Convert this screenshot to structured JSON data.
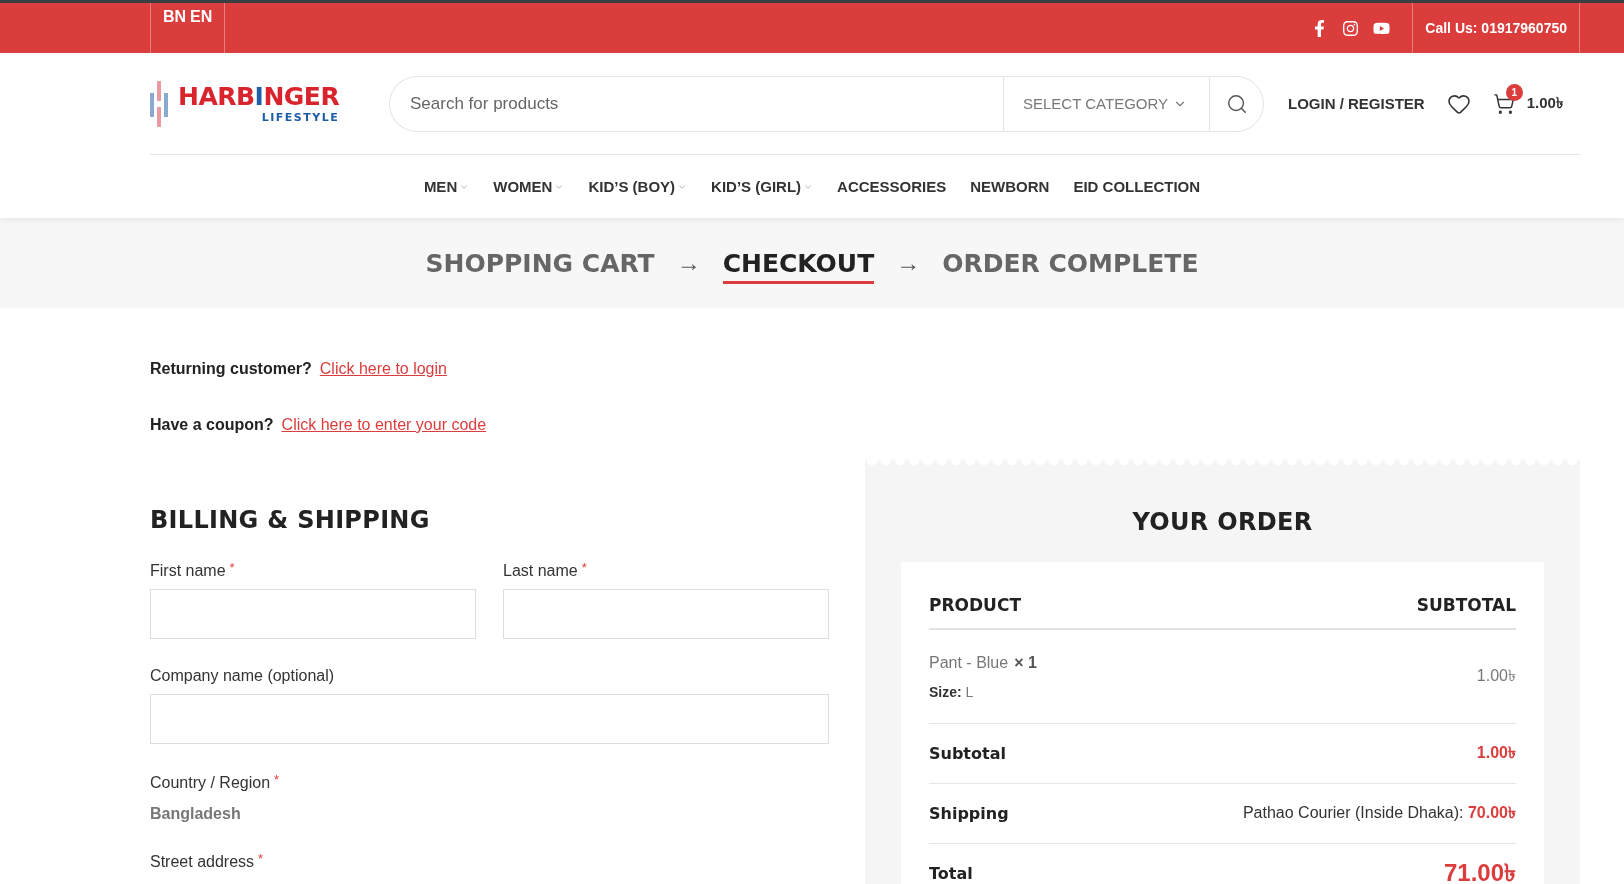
{
  "top_bar": {
    "languages": [
      "BN",
      "EN"
    ],
    "social": [
      {
        "kind": "facebook"
      },
      {
        "kind": "instagram"
      },
      {
        "kind": "youtube"
      }
    ],
    "phone": "Call Us: 01917960750"
  },
  "header": {
    "logo": {
      "parts": [
        {
          "text": "HARB",
          "color": "#d9232d"
        },
        {
          "text": "I",
          "color": "#1d5ea8"
        },
        {
          "text": "NGER",
          "color": "#d9232d"
        }
      ],
      "tagline": "LIFESTYLE"
    },
    "search": {
      "placeholder": "Search for products",
      "category": "SELECT CATEGORY"
    },
    "login": "LOGIN / REGISTER",
    "cart": {
      "count": "1",
      "total": "1.00৳"
    }
  },
  "nav": [
    {
      "label": "MEN",
      "has_dropdown": true
    },
    {
      "label": "WOMEN",
      "has_dropdown": true
    },
    {
      "label": "KID’S (BOY)",
      "has_dropdown": true
    },
    {
      "label": "KID’S (GIRL)",
      "has_dropdown": true
    },
    {
      "label": "ACCESSORIES",
      "has_dropdown": false
    },
    {
      "label": "NEWBORN",
      "has_dropdown": false
    },
    {
      "label": "EID COLLECTION",
      "has_dropdown": false
    }
  ],
  "steps": {
    "items": [
      {
        "label": "SHOPPING CART",
        "selected": false
      },
      {
        "label": "CHECKOUT",
        "selected": true
      },
      {
        "label": "ORDER COMPLETE",
        "selected": false
      }
    ],
    "arrows": [
      "→",
      "→"
    ]
  },
  "notices": [
    {
      "text": "Returning customer?",
      "link": "Click here to login"
    },
    {
      "text": "Have a coupon?",
      "link": "Click here to enter your code"
    }
  ],
  "billing": {
    "title": "BILLING & SHIPPING",
    "fields": [
      {
        "label": "First name",
        "required_mark": "*",
        "kind": "input",
        "half": true
      },
      {
        "label": "Last name",
        "required_mark": "*",
        "kind": "input",
        "half": true
      },
      {
        "label": "Company name (optional)",
        "kind": "input",
        "half": false
      },
      {
        "label": "Country / Region",
        "required_mark": "*",
        "kind": "static",
        "value": "Bangladesh",
        "half": false
      },
      {
        "label": "Street address",
        "required_mark": "*",
        "kind": "label_only",
        "half": false
      }
    ]
  },
  "order": {
    "title": "YOUR ORDER",
    "columns": [
      "PRODUCT",
      "SUBTOTAL"
    ],
    "items": [
      {
        "name": "Pant - Blue",
        "qty": "× 1",
        "meta_label": "Size:",
        "meta_value": "L",
        "price": "1.00৳"
      }
    ],
    "totals": [
      {
        "label": "Subtotal",
        "value": "1.00৳",
        "big": false
      },
      {
        "label": "Shipping",
        "method": "Pathao Courier (Inside Dhaka):",
        "value": "70.00৳",
        "big": false
      },
      {
        "label": "Total",
        "value": "71.00৳",
        "big": true
      }
    ]
  }
}
